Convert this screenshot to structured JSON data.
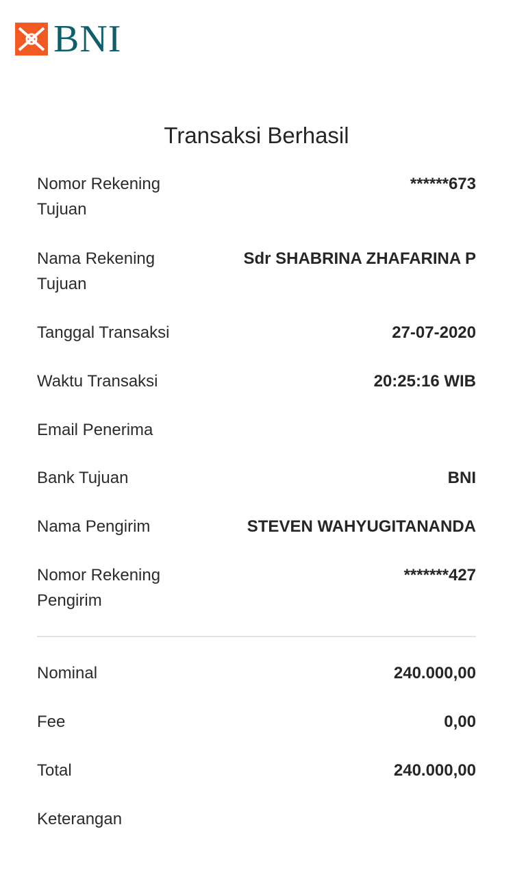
{
  "brand": {
    "name": "BNI",
    "colors": {
      "orange": "#f15a22",
      "teal": "#0f5e6b"
    }
  },
  "title": "Transaksi Berhasil",
  "details": [
    {
      "label": "Nomor Rekening Tujuan",
      "value": "******673"
    },
    {
      "label": "Nama Rekening Tujuan",
      "value": "Sdr SHABRINA ZHAFARINA P"
    },
    {
      "label": "Tanggal Transaksi",
      "value": "27-07-2020"
    },
    {
      "label": "Waktu Transaksi",
      "value": "20:25:16 WIB"
    },
    {
      "label": "Email Penerima",
      "value": ""
    },
    {
      "label": "Bank Tujuan",
      "value": "BNI"
    },
    {
      "label": "Nama Pengirim",
      "value": "STEVEN WAHYUGITANANDA"
    },
    {
      "label": "Nomor Rekening Pengirim",
      "value": "*******427"
    }
  ],
  "summary": [
    {
      "label": "Nominal",
      "value": "240.000,00"
    },
    {
      "label": "Fee",
      "value": "0,00"
    },
    {
      "label": "Total",
      "value": "240.000,00"
    },
    {
      "label": "Keterangan",
      "value": ""
    }
  ]
}
